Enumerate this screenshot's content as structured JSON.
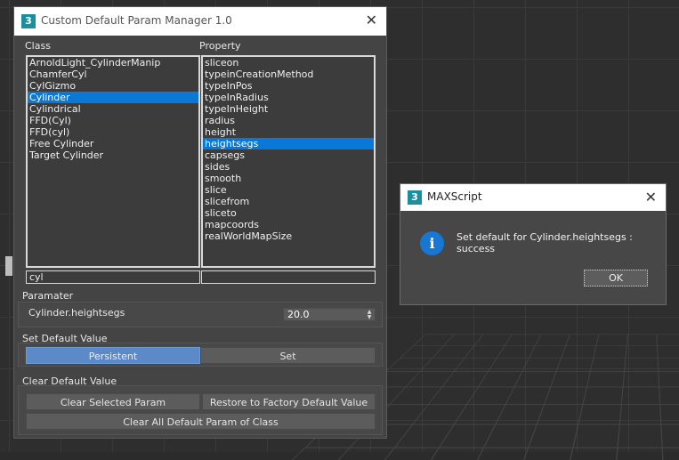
{
  "main_window": {
    "title": "Custom Default Param Manager 1.0",
    "app_icon_glyph": "3",
    "close_glyph": "✕",
    "class_label": "Class",
    "property_label": "Property",
    "class_items": [
      "ArnoldLight_CylinderManip",
      "ChamferCyl",
      "CylGizmo",
      "Cylinder",
      "Cylindrical",
      "FFD(Cyl)",
      "FFD(cyl)",
      "Free Cylinder",
      "Target Cylinder"
    ],
    "class_selected_index": 3,
    "property_items": [
      "sliceon",
      "typeinCreationMethod",
      "typeInPos",
      "typeInRadius",
      "typeInHeight",
      "radius",
      "height",
      "heightsegs",
      "capsegs",
      "sides",
      "smooth",
      "slice",
      "slicefrom",
      "sliceto",
      "mapcoords",
      "realWorldMapSize"
    ],
    "property_selected_index": 7,
    "class_filter_value": "cyl",
    "property_filter_value": "",
    "parameter_group_label": "Paramater",
    "parameter_name": "Cylinder.heightsegs",
    "parameter_value": "20.0",
    "set_default_group_label": "Set Default Value",
    "persistent_button": "Persistent",
    "set_button": "Set",
    "clear_default_group_label": "Clear Default Value",
    "clear_selected_button": "Clear Selected Param",
    "restore_factory_button": "Restore to Factory Default Value",
    "clear_all_button": "Clear All Default Param of Class"
  },
  "message_dialog": {
    "title": "MAXScript",
    "app_icon_glyph": "3",
    "close_glyph": "✕",
    "info_glyph": "i",
    "message": "Set default for Cylinder.heightsegs : success",
    "ok_button": "OK"
  },
  "icons": {
    "app": "3dsmax-logo-icon",
    "info": "information-icon",
    "close": "close-icon"
  },
  "colors": {
    "selection": "#0a78d7",
    "active_button": "#5c8ac8",
    "app_icon": "#1c8f9e",
    "info_icon": "#1877d2"
  }
}
